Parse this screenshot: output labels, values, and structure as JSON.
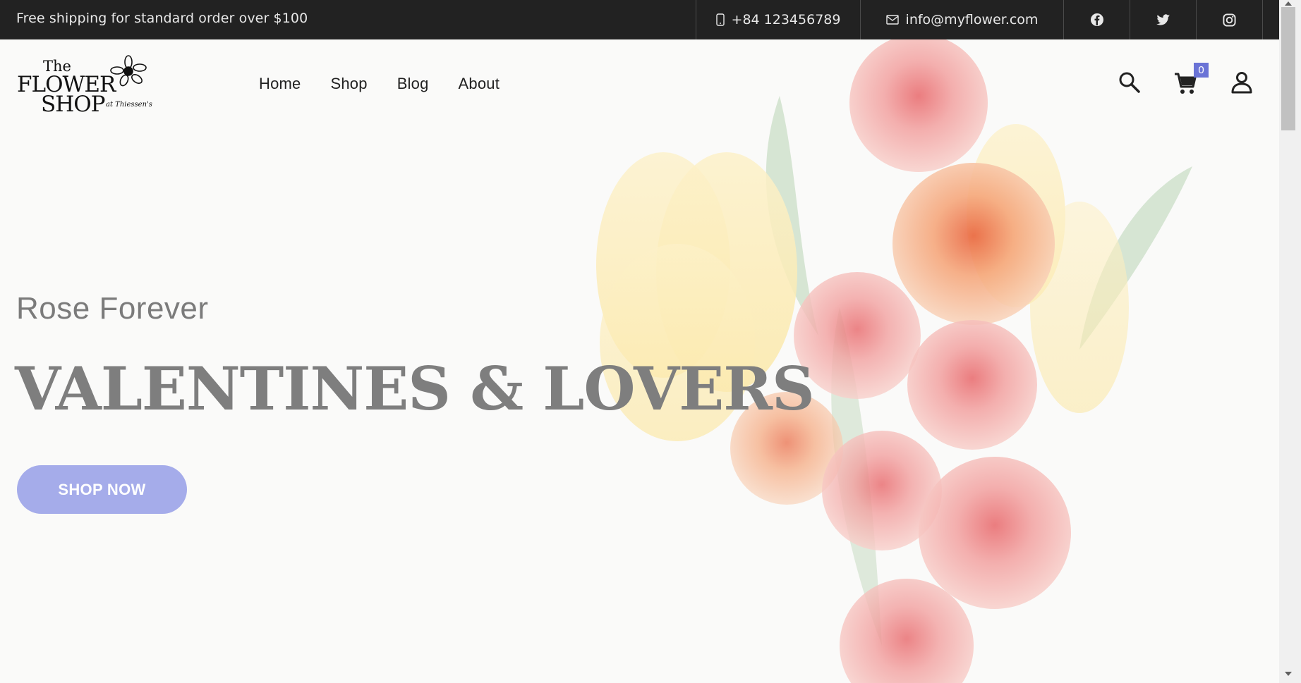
{
  "topbar": {
    "shipping_text": "Free shipping for standard order over $100",
    "phone": "+84 123456789",
    "email": "info@myflower.com",
    "social": [
      "facebook-icon",
      "twitter-icon",
      "instagram-icon"
    ]
  },
  "logo": {
    "line1": "The",
    "line2": "FLOWER",
    "line3": "SHOP",
    "tagline": "at Thiessen's"
  },
  "nav": {
    "items": [
      "Home",
      "Shop",
      "Blog",
      "About"
    ]
  },
  "header_icons": {
    "search": "search-icon",
    "cart": "cart-icon",
    "account": "user-icon",
    "cart_count": "0"
  },
  "hero": {
    "subtitle": "Rose Forever",
    "headline": "VALENTINES & LOVERS",
    "cta": "SHOP NOW"
  },
  "colors": {
    "topbar_bg": "#222222",
    "accent": "#a5acea",
    "badge": "#6a73d6",
    "headline": "#7e7e7e"
  }
}
